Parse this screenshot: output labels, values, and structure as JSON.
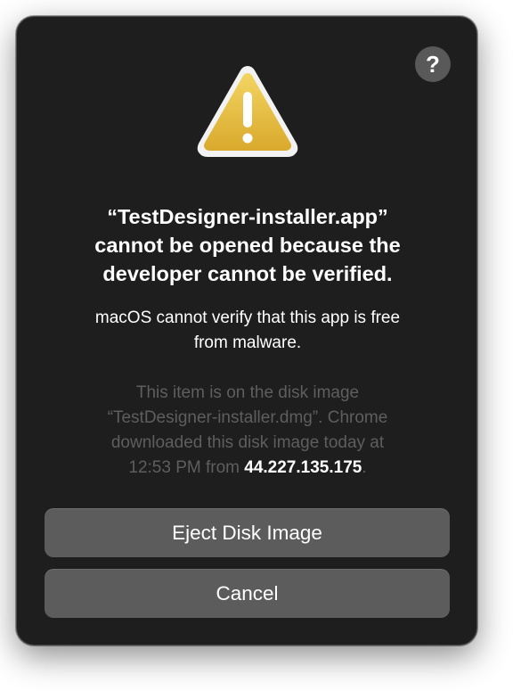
{
  "dialog": {
    "help_glyph": "?",
    "icon": "warning-triangle-icon",
    "title_line1": "“TestDesigner-installer.app”",
    "title_line2": "cannot be opened because the",
    "title_line3": "developer cannot be verified.",
    "subtitle_line1": "macOS cannot verify that this app is free",
    "subtitle_line2": "from malware.",
    "info_line1": "This item is on the disk image",
    "info_line2": "“TestDesigner-installer.dmg”. Chrome",
    "info_line3": "downloaded this disk image today at",
    "info_line4_prefix": "12:53 PM from ",
    "info_ip": "44.227.135.175",
    "info_line4_suffix": ".",
    "buttons": {
      "eject_label": "Eject Disk Image",
      "cancel_label": "Cancel"
    }
  },
  "colors": {
    "dialog_bg": "#1e1e1e",
    "button_bg": "#5c5c5c",
    "info_text": "#5e5e5e",
    "warning_yellow": "#e8c44a"
  }
}
